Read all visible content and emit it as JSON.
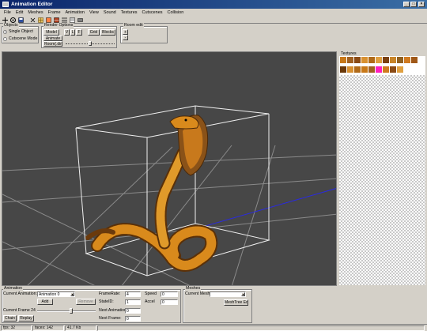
{
  "window": {
    "title": "Animation Editor"
  },
  "menu": [
    "File",
    "Edit",
    "Meshes",
    "Frame",
    "Animation",
    "View",
    "Sound",
    "Textures",
    "Cutscenes",
    "Collision"
  ],
  "objects_group": {
    "label": "Objects",
    "single_object": "Single Object",
    "cutscene_mode": "Cutscene Mode",
    "selected": "single_object"
  },
  "render_options": {
    "label": "Render Options",
    "model": "Model",
    "v": "V",
    "l": "L",
    "f": "F",
    "grid": "Grid",
    "blocks": "Blocks",
    "animate": "Animate",
    "room_dir": "Room(.dir)"
  },
  "room_edit": {
    "label": "Room edit",
    "plus": "+",
    "minus": "-"
  },
  "textures": {
    "label": "Textures"
  },
  "animation": {
    "label": "Animation",
    "current_animation_label": "Current Animation:",
    "current_animation_value": "Animation 0",
    "add": "Add",
    "remove": "Remove",
    "current_frame_label": "Current Frame 24",
    "current_frame_level": 0.58,
    "chain": "Chain",
    "replay": "Replay",
    "framerate_label": "FrameRate:",
    "framerate": "4",
    "speed_label": "Speed",
    "speed": "0",
    "stateid_label": "StateID:",
    "stateid": "1",
    "accel_label": "Accel",
    "accel": "0",
    "next_animation_label": "Next Animation:",
    "next_animation": "0",
    "next_frame_label": "Next Frame:",
    "next_frame": "0"
  },
  "meshes": {
    "label": "Meshes",
    "current_mesh_label": "Current Mesh:",
    "current_mesh": "",
    "meshtree_edit": "MeshTree Edit"
  },
  "status": {
    "fps": "fps: 32",
    "faces": "faces: 142",
    "size": "41.7 Kb"
  },
  "colors": {
    "viewport_bg": "#474747",
    "title_blue": "#0a246a",
    "snake_orange": "#d98a1c",
    "snake_dark": "#6b3a0c"
  }
}
